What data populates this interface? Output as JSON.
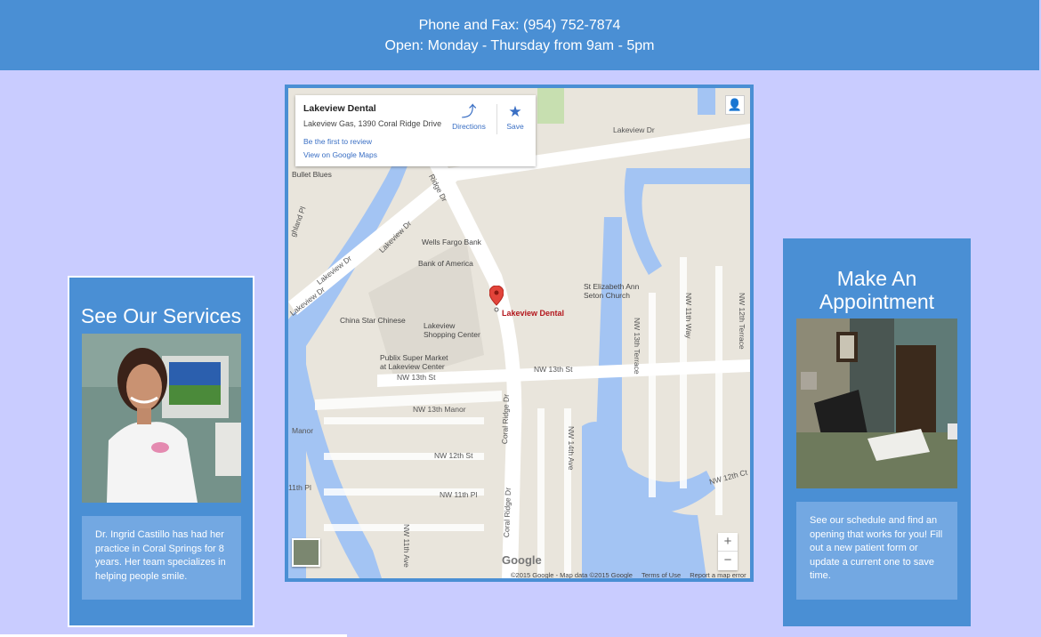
{
  "header": {
    "phone_line": "Phone and Fax: (954) 752-7874",
    "hours_line": "Open: Monday - Thursday from 9am - 5pm"
  },
  "services": {
    "title": "See Our Services",
    "description": "Dr. Ingrid Castillo has had her practice in Coral Springs for 8 years. Her team specializes in helping people smile."
  },
  "appointment": {
    "title": "Make An Appointment",
    "description": "See our schedule and find an opening that works for you! Fill out a new patient form or update a current one to save time."
  },
  "map": {
    "place_name": "Lakeview Dental",
    "place_address": "Lakeview Gas, 1390 Coral Ridge Drive",
    "review_link": "Be the first to review",
    "view_link": "View on Google Maps",
    "directions_label": "Directions",
    "save_label": "Save",
    "pin_label": "Lakeview Dental",
    "google_logo": "Google",
    "attribution": "©2015 Google - Map data ©2015 Google",
    "terms_link": "Terms of Use",
    "report_link": "Report a map error",
    "zoom_in": "+",
    "zoom_out": "−",
    "labels": {
      "lakeview_dr_top": "Lakeview Dr",
      "lakeview_dr_mid": "Lakeview Dr",
      "lakeview_dr_left": "Lakeview Dr",
      "lakeview_dr_left2": "Lakeview Dr",
      "ridge_dr": "Ridge Dr",
      "coral_ridge_dr_1": "Coral Ridge Dr",
      "coral_ridge_dr_2": "Coral Ridge Dr",
      "highland_pl": "ghland Pl",
      "bullet_blues": "Bullet Blues",
      "wells_fargo": "Wells Fargo Bank",
      "bank_of_america": "Bank of America",
      "china_star": "China Star Chinese",
      "lakeview_shopping": "Lakeview\nShopping Center",
      "publix": "Publix Super Market\nat Lakeview Center",
      "st_elizabeth": "St Elizabeth Ann\nSeton Church",
      "nw_13th_st_left": "NW 13th St",
      "nw_13th_st_right": "NW 13th St",
      "nw_13th_manor": "NW 13th Manor",
      "manor_left": "Manor",
      "nw_12th_st": "NW 12th St",
      "nw_11th_pl": "NW 11th Pl",
      "th_pl_left": "11th Pl",
      "nw_11th_ave": "NW 11th Ave",
      "nw_14th_ave": "NW 14th Ave",
      "nw_13th_terrace": "NW 13th Terrace",
      "nw_11th_way": "NW 11th Way",
      "nw_12th_terrace": "NW 12th Terrace",
      "nw_12th_ct": "NW 12th Ct",
      "nw_11th_ave_b": "NW 1"
    }
  }
}
